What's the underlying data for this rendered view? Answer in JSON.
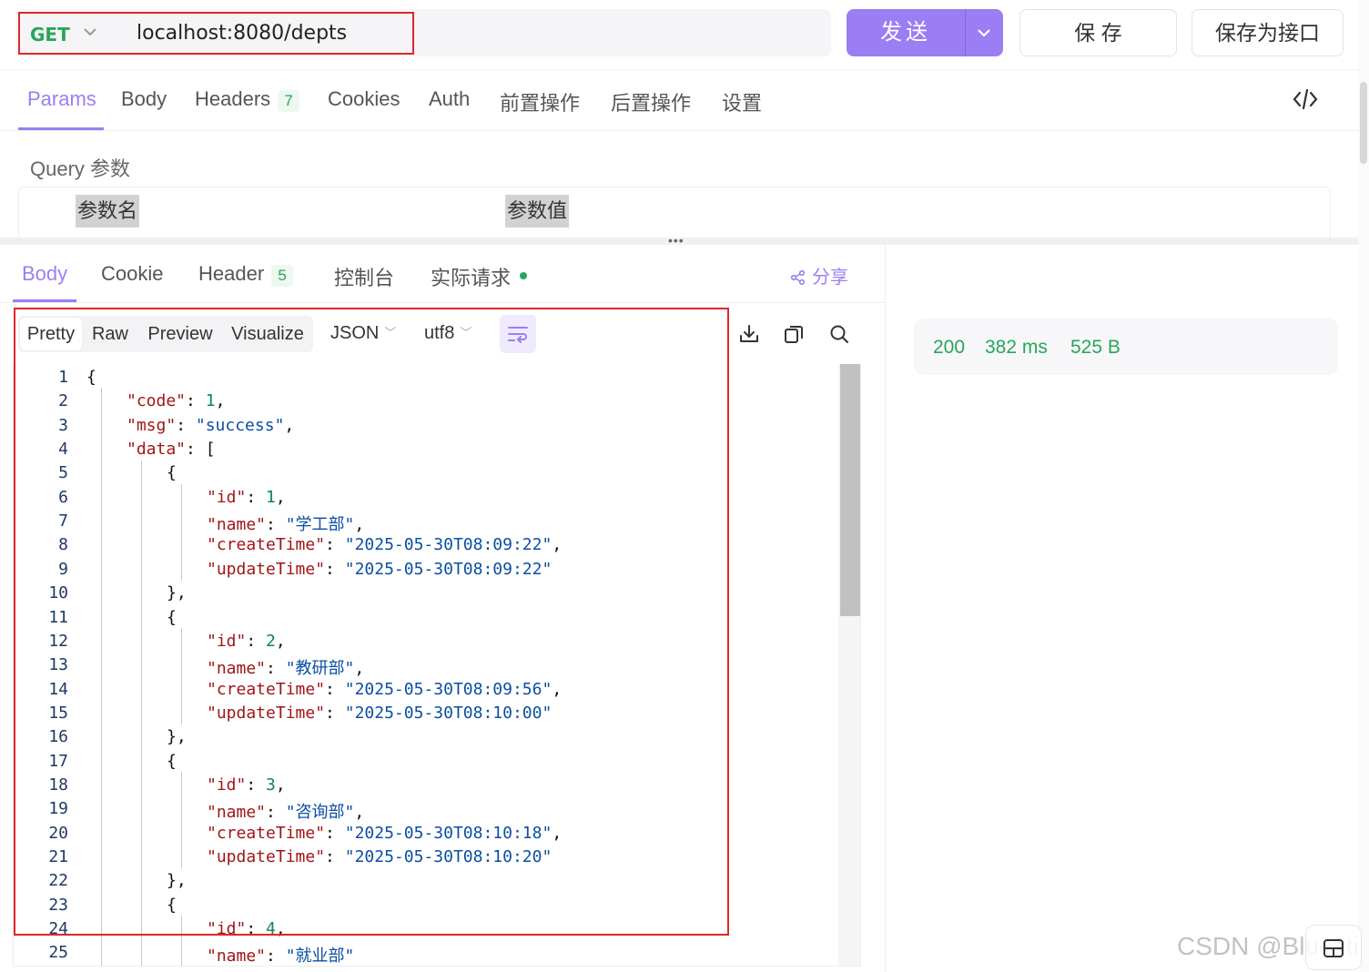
{
  "request": {
    "method": "GET",
    "url": "localhost:8080/depts",
    "send_label": "发送",
    "save_label": "保 存",
    "save_as_api_label": "保存为接口"
  },
  "request_tabs": [
    {
      "label": "Params",
      "active": true
    },
    {
      "label": "Body"
    },
    {
      "label": "Headers",
      "badge": "7"
    },
    {
      "label": "Cookies"
    },
    {
      "label": "Auth"
    },
    {
      "label": "前置操作"
    },
    {
      "label": "后置操作"
    },
    {
      "label": "设置"
    }
  ],
  "query": {
    "title": "Query 参数",
    "col_name": "参数名",
    "col_value": "参数值"
  },
  "response_tabs": [
    {
      "label": "Body",
      "active": true
    },
    {
      "label": "Cookie"
    },
    {
      "label": "Header",
      "badge": "5"
    },
    {
      "label": "控制台"
    },
    {
      "label": "实际请求"
    }
  ],
  "share_label": "分享",
  "view_modes": [
    "Pretty",
    "Raw",
    "Preview",
    "Visualize"
  ],
  "format_select": "JSON",
  "encoding_select": "utf8",
  "status": {
    "code": "200",
    "time": "382 ms",
    "size": "525 B"
  },
  "line_numbers": [
    "1",
    "2",
    "3",
    "4",
    "5",
    "6",
    "7",
    "8",
    "9",
    "10",
    "11",
    "12",
    "13",
    "14",
    "15",
    "16",
    "17",
    "18",
    "19",
    "20",
    "21",
    "22",
    "23",
    "24",
    "25"
  ],
  "json_body": {
    "code": 1,
    "msg": "success",
    "data": [
      {
        "id": 1,
        "name": "学工部",
        "createTime": "2025-05-30T08:09:22",
        "updateTime": "2025-05-30T08:09:22"
      },
      {
        "id": 2,
        "name": "教研部",
        "createTime": "2025-05-30T08:09:56",
        "updateTime": "2025-05-30T08:10:00"
      },
      {
        "id": 3,
        "name": "咨询部",
        "createTime": "2025-05-30T08:10:18",
        "updateTime": "2025-05-30T08:10:20"
      },
      {
        "id": 4,
        "name": "就业部"
      }
    ]
  },
  "watermark": "CSDN @Bluezti",
  "colors": {
    "accent": "#9b7ef3",
    "method_green": "#27a65a",
    "highlight_red": "#e0262b"
  }
}
